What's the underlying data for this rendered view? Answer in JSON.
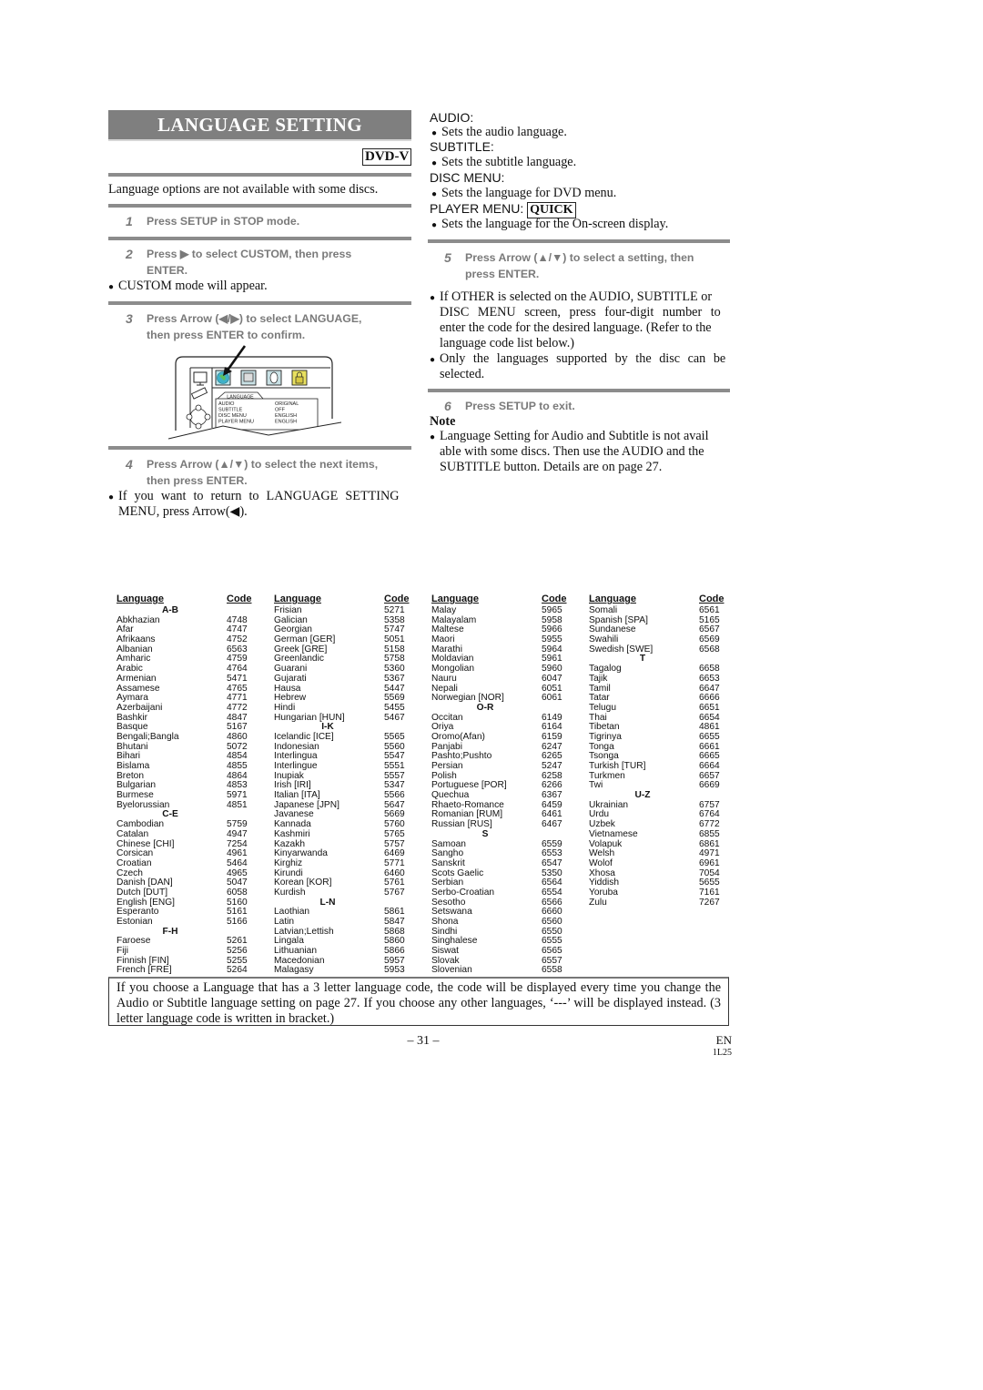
{
  "title": "LANGUAGE SETTING",
  "badge": "DVD-V",
  "intro": "Language options are not available with some discs.",
  "bullet": "●",
  "steps": [
    {
      "num": "1",
      "line1": "Press SETUP in STOP mode.",
      "line2": ""
    },
    {
      "num": "2",
      "line1": "Press ▶ to select CUSTOM, then press",
      "line2": "ENTER."
    },
    {
      "num": "3",
      "line1": "Press Arrow (◀/▶) to select LANGUAGE,",
      "line2": "then press ENTER to confirm."
    },
    {
      "num": "4",
      "line1": "Press Arrow (▲/▼) to select the next items,",
      "line2": "then press ENTER."
    },
    {
      "num": "5",
      "line1": "Press Arrow (▲/▼) to select a setting, then",
      "line2": "press ENTER."
    },
    {
      "num": "6",
      "line1": "Press SETUP to exit.",
      "line2": ""
    }
  ],
  "step2_note": "CUSTOM mode will appear.",
  "step4_note_line1": "If you want to return to LANGUAGE SETTING",
  "step4_note_line2": "MENU, press Arrow(◀).",
  "diagram": {
    "tab_label": "LANGUAGE",
    "rows": [
      {
        "item": "AUDIO",
        "value": "ORIGINAL"
      },
      {
        "item": "SUBTITLE",
        "value": "OFF"
      },
      {
        "item": "DISC MENU",
        "value": "ENGLISH"
      },
      {
        "item": "PLAYER MENU",
        "value": "ENGLISH"
      }
    ],
    "icons": [
      "language-globe-icon",
      "display-icon",
      "audio-speaker-icon",
      "parental-lock-icon"
    ],
    "selected_color": "#3fb0c8",
    "lock_color": "#e8e060"
  },
  "settings": [
    {
      "heading": "AUDIO:",
      "badge": "",
      "desc": "Sets the audio language."
    },
    {
      "heading": "SUBTITLE:",
      "badge": "",
      "desc": "Sets the subtitle language."
    },
    {
      "heading": "DISC MENU:",
      "badge": "",
      "desc": "Sets the language for DVD menu."
    },
    {
      "heading": "PLAYER MENU:",
      "badge": "QUICK",
      "desc": "Sets the language for the On-screen display."
    }
  ],
  "step5_notes": [
    [
      "If OTHER is selected on the AUDIO, SUBTITLE or",
      "DISC MENU screen, press four-digit number to",
      "enter the code for the desired language. (Refer to the",
      "language code list below.)"
    ],
    [
      "Only the languages supported by the disc can be",
      "selected."
    ]
  ],
  "note_heading": "Note",
  "note_lines": [
    "Language Setting for Audio and Subtitle is not avail",
    "able with some discs. Then use the AUDIO and the",
    "SUBTITLE button. Details are on page 27."
  ],
  "table": {
    "header_language": "Language",
    "header_code": "Code",
    "columns": [
      [
        {
          "group": "A-B"
        },
        {
          "name": "Abkhazian",
          "code": "4748"
        },
        {
          "name": "Afar",
          "code": "4747"
        },
        {
          "name": "Afrikaans",
          "code": "4752"
        },
        {
          "name": "Albanian",
          "code": "6563"
        },
        {
          "name": "Amharic",
          "code": "4759"
        },
        {
          "name": "Arabic",
          "code": "4764"
        },
        {
          "name": "Armenian",
          "code": "5471"
        },
        {
          "name": "Assamese",
          "code": "4765"
        },
        {
          "name": "Aymara",
          "code": "4771"
        },
        {
          "name": "Azerbaijani",
          "code": "4772"
        },
        {
          "name": "Bashkir",
          "code": "4847"
        },
        {
          "name": "Basque",
          "code": "5167"
        },
        {
          "name": "Bengali;Bangla",
          "code": "4860"
        },
        {
          "name": "Bhutani",
          "code": "5072"
        },
        {
          "name": "Bihari",
          "code": "4854"
        },
        {
          "name": "Bislama",
          "code": "4855"
        },
        {
          "name": "Breton",
          "code": "4864"
        },
        {
          "name": "Bulgarian",
          "code": "4853"
        },
        {
          "name": "Burmese",
          "code": "5971"
        },
        {
          "name": "Byelorussian",
          "code": "4851"
        },
        {
          "group": "C-E"
        },
        {
          "name": "Cambodian",
          "code": "5759"
        },
        {
          "name": "Catalan",
          "code": "4947"
        },
        {
          "name": "Chinese [CHI]",
          "code": "7254"
        },
        {
          "name": "Corsican",
          "code": "4961"
        },
        {
          "name": "Croatian",
          "code": "5464"
        },
        {
          "name": "Czech",
          "code": "4965"
        },
        {
          "name": "Danish [DAN]",
          "code": "5047"
        },
        {
          "name": "Dutch [DUT]",
          "code": "6058"
        },
        {
          "name": "English [ENG]",
          "code": "5160"
        },
        {
          "name": "Esperanto",
          "code": "5161"
        },
        {
          "name": "Estonian",
          "code": "5166"
        },
        {
          "group": "F-H"
        },
        {
          "name": "Faroese",
          "code": "5261"
        },
        {
          "name": "Fiji",
          "code": "5256"
        },
        {
          "name": "Finnish [FIN]",
          "code": "5255"
        },
        {
          "name": "French [FRE]",
          "code": "5264"
        }
      ],
      [
        {
          "name": "Frisian",
          "code": "5271"
        },
        {
          "name": "Galician",
          "code": "5358"
        },
        {
          "name": "Georgian",
          "code": "5747"
        },
        {
          "name": "German [GER]",
          "code": "5051"
        },
        {
          "name": "Greek [GRE]",
          "code": "5158"
        },
        {
          "name": "Greenlandic",
          "code": "5758"
        },
        {
          "name": "Guarani",
          "code": "5360"
        },
        {
          "name": "Gujarati",
          "code": "5367"
        },
        {
          "name": "Hausa",
          "code": "5447"
        },
        {
          "name": "Hebrew",
          "code": "5569"
        },
        {
          "name": "Hindi",
          "code": "5455"
        },
        {
          "name": "Hungarian [HUN]",
          "code": "5467"
        },
        {
          "group": "I-K"
        },
        {
          "name": "Icelandic [ICE]",
          "code": "5565"
        },
        {
          "name": "Indonesian",
          "code": "5560"
        },
        {
          "name": "Interlingua",
          "code": "5547"
        },
        {
          "name": "Interlingue",
          "code": "5551"
        },
        {
          "name": "Inupiak",
          "code": "5557"
        },
        {
          "name": "Irish [IRI]",
          "code": "5347"
        },
        {
          "name": "Italian [ITA]",
          "code": "5566"
        },
        {
          "name": "Japanese [JPN]",
          "code": "5647"
        },
        {
          "name": "Javanese",
          "code": "5669"
        },
        {
          "name": "Kannada",
          "code": "5760"
        },
        {
          "name": "Kashmiri",
          "code": "5765"
        },
        {
          "name": "Kazakh",
          "code": "5757"
        },
        {
          "name": "Kinyarwanda",
          "code": "6469"
        },
        {
          "name": "Kirghiz",
          "code": "5771"
        },
        {
          "name": "Kirundi",
          "code": "6460"
        },
        {
          "name": "Korean [KOR]",
          "code": "5761"
        },
        {
          "name": "Kurdish",
          "code": "5767"
        },
        {
          "group": "L-N"
        },
        {
          "name": "Laothian",
          "code": "5861"
        },
        {
          "name": "Latin",
          "code": "5847"
        },
        {
          "name": "Latvian;Lettish",
          "code": "5868"
        },
        {
          "name": "Lingala",
          "code": "5860"
        },
        {
          "name": "Lithuanian",
          "code": "5866"
        },
        {
          "name": "Macedonian",
          "code": "5957"
        },
        {
          "name": "Malagasy",
          "code": "5953"
        }
      ],
      [
        {
          "name": "Malay",
          "code": "5965"
        },
        {
          "name": "Malayalam",
          "code": "5958"
        },
        {
          "name": "Maltese",
          "code": "5966"
        },
        {
          "name": "Maori",
          "code": "5955"
        },
        {
          "name": "Marathi",
          "code": "5964"
        },
        {
          "name": "Moldavian",
          "code": "5961"
        },
        {
          "name": "Mongolian",
          "code": "5960"
        },
        {
          "name": "Nauru",
          "code": "6047"
        },
        {
          "name": "Nepali",
          "code": "6051"
        },
        {
          "name": "Norwegian [NOR]",
          "code": "6061"
        },
        {
          "group": "O-R"
        },
        {
          "name": "Occitan",
          "code": "6149"
        },
        {
          "name": "Oriya",
          "code": "6164"
        },
        {
          "name": "Oromo(Afan)",
          "code": "6159"
        },
        {
          "name": "Panjabi",
          "code": "6247"
        },
        {
          "name": "Pashto;Pushto",
          "code": "6265"
        },
        {
          "name": "Persian",
          "code": "5247"
        },
        {
          "name": "Polish",
          "code": "6258"
        },
        {
          "name": "Portuguese [POR]",
          "code": "6266"
        },
        {
          "name": "Quechua",
          "code": "6367"
        },
        {
          "name": "Rhaeto-Romance",
          "code": "6459"
        },
        {
          "name": "Romanian [RUM]",
          "code": "6461"
        },
        {
          "name": "Russian [RUS]",
          "code": "6467"
        },
        {
          "group": "S"
        },
        {
          "name": "Samoan",
          "code": "6559"
        },
        {
          "name": "Sangho",
          "code": "6553"
        },
        {
          "name": "Sanskrit",
          "code": "6547"
        },
        {
          "name": "Scots Gaelic",
          "code": "5350"
        },
        {
          "name": "Serbian",
          "code": "6564"
        },
        {
          "name": "Serbo-Croatian",
          "code": "6554"
        },
        {
          "name": "Sesotho",
          "code": "6566"
        },
        {
          "name": "Setswana",
          "code": "6660"
        },
        {
          "name": "Shona",
          "code": "6560"
        },
        {
          "name": "Sindhi",
          "code": "6550"
        },
        {
          "name": "Singhalese",
          "code": "6555"
        },
        {
          "name": "Siswat",
          "code": "6565"
        },
        {
          "name": "Slovak",
          "code": "6557"
        },
        {
          "name": "Slovenian",
          "code": "6558"
        }
      ],
      [
        {
          "name": "Somali",
          "code": "6561"
        },
        {
          "name": "Spanish [SPA]",
          "code": "5165"
        },
        {
          "name": "Sundanese",
          "code": "6567"
        },
        {
          "name": "Swahili",
          "code": "6569"
        },
        {
          "name": "Swedish [SWE]",
          "code": "6568"
        },
        {
          "group": "T"
        },
        {
          "name": "Tagalog",
          "code": "6658"
        },
        {
          "name": "Tajik",
          "code": "6653"
        },
        {
          "name": "Tamil",
          "code": "6647"
        },
        {
          "name": "Tatar",
          "code": "6666"
        },
        {
          "name": "Telugu",
          "code": "6651"
        },
        {
          "name": "Thai",
          "code": "6654"
        },
        {
          "name": "Tibetan",
          "code": "4861"
        },
        {
          "name": "Tigrinya",
          "code": "6655"
        },
        {
          "name": "Tonga",
          "code": "6661"
        },
        {
          "name": "Tsonga",
          "code": "6665"
        },
        {
          "name": "Turkish [TUR]",
          "code": "6664"
        },
        {
          "name": "Turkmen",
          "code": "6657"
        },
        {
          "name": "Twi",
          "code": "6669"
        },
        {
          "group": "U-Z"
        },
        {
          "name": "Ukrainian",
          "code": "6757"
        },
        {
          "name": "Urdu",
          "code": "6764"
        },
        {
          "name": "Uzbek",
          "code": "6772"
        },
        {
          "name": "Vietnamese",
          "code": "6855"
        },
        {
          "name": "Volapuk",
          "code": "6861"
        },
        {
          "name": "Welsh",
          "code": "4971"
        },
        {
          "name": "Wolof",
          "code": "6961"
        },
        {
          "name": "Xhosa",
          "code": "7054"
        },
        {
          "name": "Yiddish",
          "code": "5655"
        },
        {
          "name": "Yoruba",
          "code": "7161"
        },
        {
          "name": "Zulu",
          "code": "7267"
        }
      ]
    ]
  },
  "footer_note": "If you choose a Language that has a 3 letter language code, the code will be displayed every time you change the Audio or Subtitle language setting on page 27. If you choose any other languages, ‘---’ will be displayed instead. (3 letter language code is written in bracket.)",
  "page_number": "– 31 –",
  "language_tag": "EN",
  "model_tag": "1L25"
}
